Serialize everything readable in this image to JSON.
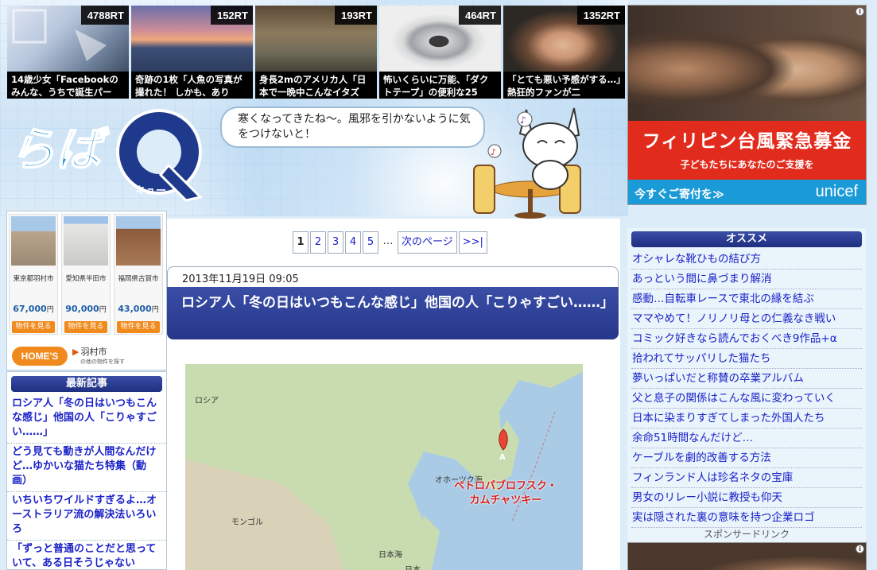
{
  "thumbs": [
    {
      "rt": "4788RT",
      "caption": "14歳少女「Facebookのみんな、うちで誕生パー"
    },
    {
      "rt": "152RT",
      "caption": "奇跡の1枚「人魚の写真が撮れた！ しかも、あり"
    },
    {
      "rt": "193RT",
      "caption": "身長2mのアメリカ人「日本で一晩中こんなイタズ"
    },
    {
      "rt": "464RT",
      "caption": "怖いくらいに万能、「ダクトテープ」の便利な25"
    },
    {
      "rt": "1352RT",
      "caption": "「とても悪い予感がする…」熱狂的ファンが二"
    }
  ],
  "logo": {
    "text": "らば",
    "sub": "キュー",
    "q": "Q"
  },
  "speech": "寒くなってきたね〜。風邪を引かないように気をつけないと！",
  "ad_top": {
    "headline": "フィリピン台風緊急募金",
    "sub": "子どもたちにあなたのご支援を",
    "donate": "今すぐご寄付を≫",
    "brand": "unicef"
  },
  "adinfo": "i",
  "property_ad": {
    "items": [
      {
        "location": "東京都羽村市",
        "price": "67,000",
        "unit": "円",
        "button": "物件を見る"
      },
      {
        "location": "愛知県半田市",
        "price": "90,000",
        "unit": "円",
        "button": "物件を見る"
      },
      {
        "location": "福岡県古賀市",
        "price": "43,000",
        "unit": "円",
        "button": "物件を見る"
      }
    ],
    "brand": "HOME'S",
    "city_arrow": "▶",
    "city": "羽村市",
    "city_sub": "の他の物件を探す"
  },
  "latest": {
    "title": "最新記事",
    "items": [
      "ロシア人「冬の日はいつもこんな感じ」他国の人「こりゃすごい……」",
      "どう見ても動きが人間なんだけど…ゆかいな猫たち特集（動画）",
      "いちいちワイルドすぎるよ…オーストラリア流の解決法いろいろ",
      "「ずっと普通のことだと思っていて、ある日そうじゃない"
    ]
  },
  "pager": {
    "pages": [
      "1",
      "2",
      "3",
      "4",
      "5"
    ],
    "current": "1",
    "dots": "…",
    "next": "次のページ",
    "last": ">>|"
  },
  "article": {
    "date": "2013年11月19日 09:05",
    "title": "ロシア人「冬の日はいつもこんな感じ」他国の人「こりゃすごい……」"
  },
  "map": {
    "labels": {
      "russia": "ロシア",
      "mongolia": "モンゴル",
      "okhotsk": "オホーツク海",
      "japan_sea": "日本海",
      "japan": "日本"
    },
    "marker": "A",
    "city_line1": "ペトロパブロフスク・",
    "city_line2": "カムチャツキー"
  },
  "osusume": {
    "title": "オススメ",
    "items": [
      "オシャレな靴ひもの結び方",
      "あっという間に鼻づまり解消",
      "感動…自転車レースで東北の縁を結ぶ",
      "ママやめて！ノリノリ母との仁義なき戦い",
      "コミック好きなら読んでおくべき9作品+α",
      "拾われてサッパリした猫たち",
      "夢いっぱいだと称賛の卒業アルバム",
      "父と息子の関係はこんな風に変わっていく",
      "日本に染まりすぎてしまった外国人たち",
      "余命51時間なんだけど…",
      "ケーブルを劇的改善する方法",
      "フィンランド人は珍名ネタの宝庫",
      "男女のリレー小説に教授も仰天",
      "実は隠された裏の意味を持つ企業ロゴ"
    ]
  },
  "sponsor": "スポンサードリンク",
  "colors": {
    "accent_blue": "#2a3a92",
    "link": "#1a22c8",
    "unicef_red": "#e12b1d",
    "unicef_blue": "#1a9ad6",
    "homes_orange": "#f08a1c"
  }
}
